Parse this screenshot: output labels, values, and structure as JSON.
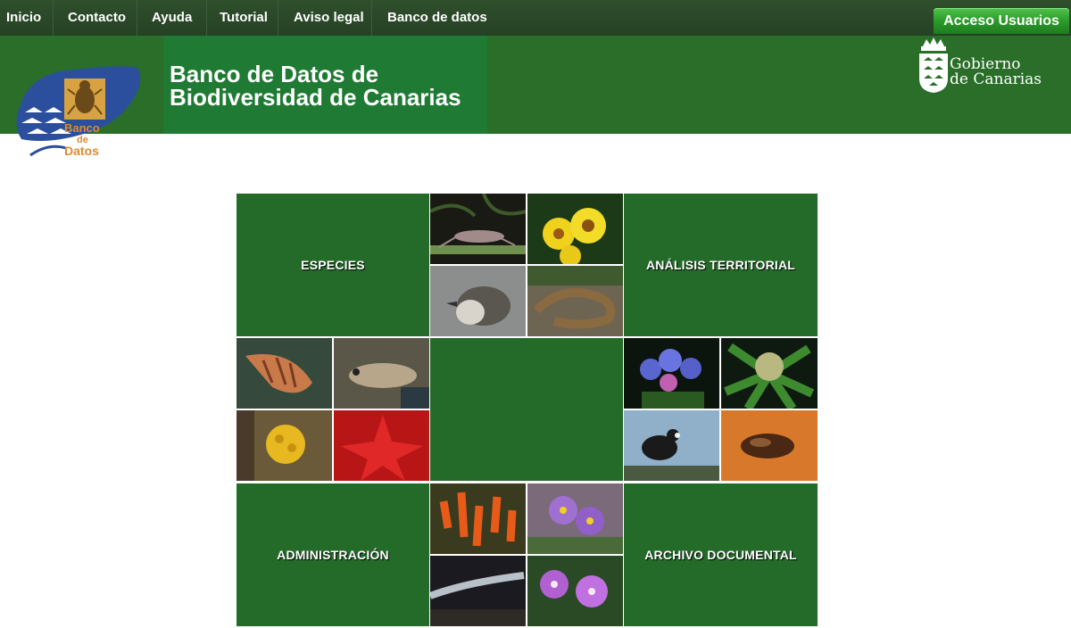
{
  "nav": {
    "items": [
      {
        "label": "Inicio"
      },
      {
        "label": "Contacto"
      },
      {
        "label": "Ayuda"
      },
      {
        "label": "Tutorial"
      },
      {
        "label": "Aviso legal"
      },
      {
        "label": "Banco de datos"
      }
    ],
    "login_label": "Acceso Usuarios"
  },
  "header": {
    "title_line1": "Banco de Datos de",
    "title_line2": "Biodiversidad de Canarias",
    "logo": {
      "line1": "Banco",
      "line2": "de",
      "line3": "Datos"
    },
    "gov": {
      "line1": "Gobierno",
      "line2": "de Canarias"
    }
  },
  "panels": {
    "especies": "ESPECIES",
    "analisis": "ANÁLISIS TERRITORIAL",
    "administracion": "ADMINISTRACIÓN",
    "archivo": "ARCHIVO DOCUMENTAL"
  },
  "colors": {
    "nav_bg": "#2f4f2c",
    "header_bg": "#2a6e2a",
    "panel_bg": "#246b2a",
    "login_btn": "#2c9a2b"
  }
}
